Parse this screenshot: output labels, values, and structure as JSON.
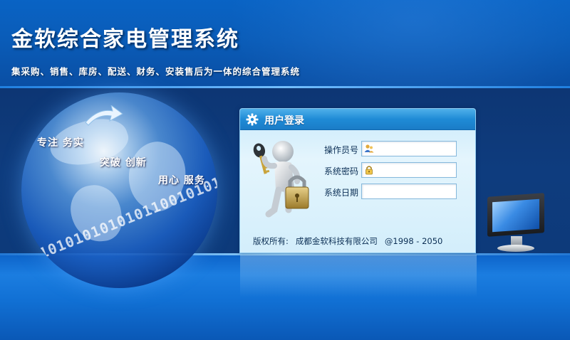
{
  "header": {
    "title": "金软综合家电管理系统",
    "subtitle": "集采购、销售、库房、配送、财务、安装售后为一体的综合管理系统"
  },
  "hero": {
    "slogans": [
      "专注 务实",
      "突破 创新",
      "用心 服务"
    ],
    "binary_text": "01101010101010110010101010"
  },
  "login": {
    "title": "用户登录",
    "fields": [
      {
        "label": "操作员号",
        "value": "",
        "icon": "user-icon"
      },
      {
        "label": "系统密码",
        "value": "",
        "icon": "lock-icon"
      },
      {
        "label": "系统日期",
        "value": ""
      }
    ],
    "footer": {
      "copyright_label": "版权所有:",
      "company": "成都金软科技有限公司",
      "years": "@1998 - 2050"
    }
  },
  "colors": {
    "header_blue": "#0a5cb8",
    "panel_header": "#1f8bd6",
    "panel_bg": "#e4f5fd",
    "text_dark": "#0c2f55"
  }
}
